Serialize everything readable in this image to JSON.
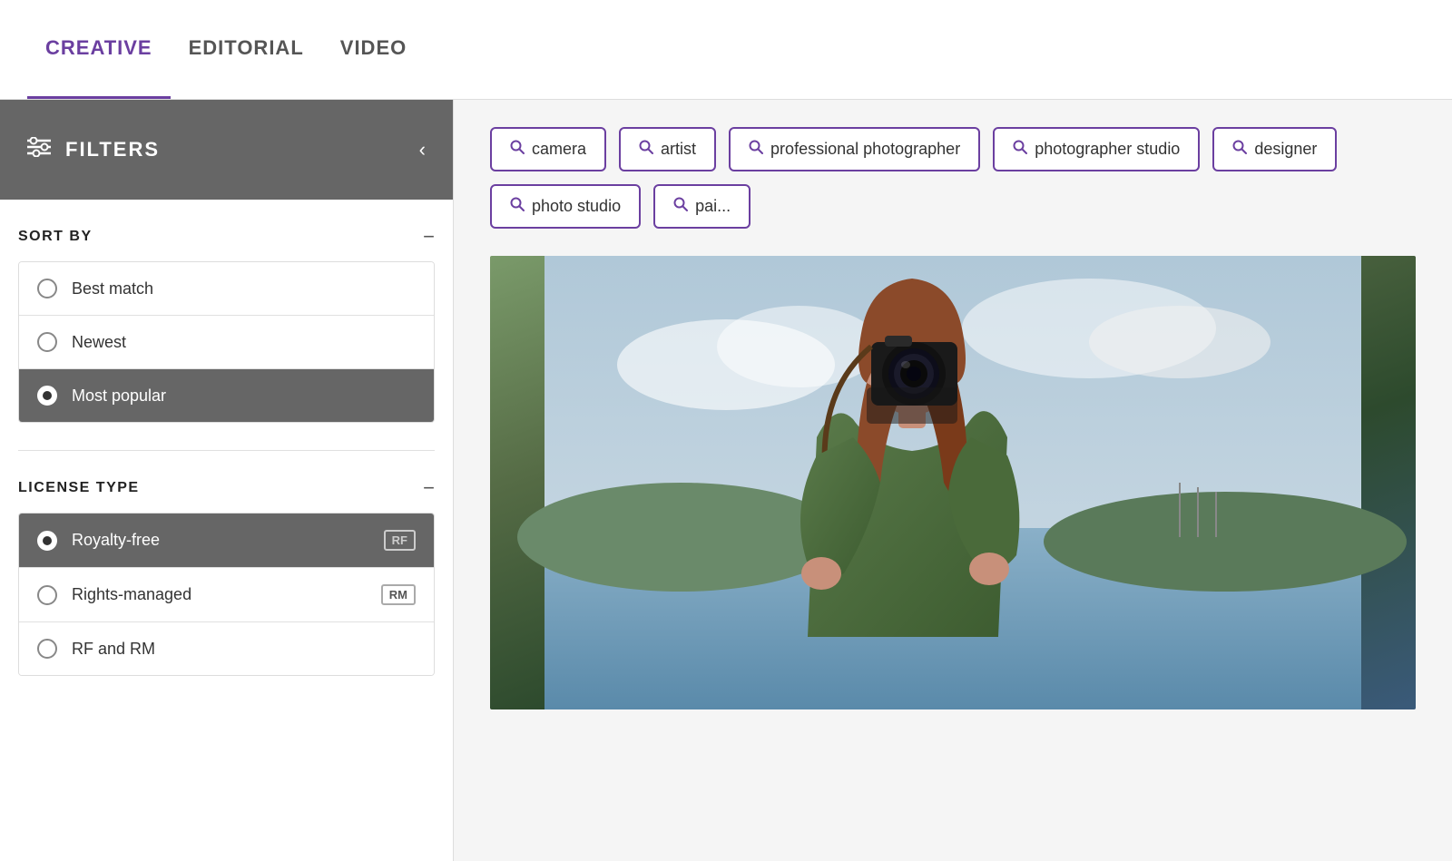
{
  "tabs": [
    {
      "id": "creative",
      "label": "CREATIVE",
      "active": true
    },
    {
      "id": "editorial",
      "label": "EDITORIAL",
      "active": false
    },
    {
      "id": "video",
      "label": "VIDEO",
      "active": false
    }
  ],
  "sidebar": {
    "header": {
      "filters_label": "FILTERS",
      "collapse_icon": "‹"
    },
    "sort_by": {
      "title": "SORT BY",
      "options": [
        {
          "id": "best-match",
          "label": "Best match",
          "selected": false
        },
        {
          "id": "newest",
          "label": "Newest",
          "selected": false
        },
        {
          "id": "most-popular",
          "label": "Most popular",
          "selected": true
        }
      ]
    },
    "license_type": {
      "title": "LICENSE TYPE",
      "options": [
        {
          "id": "royalty-free",
          "label": "Royalty-free",
          "badge": "RF",
          "selected": true
        },
        {
          "id": "rights-managed",
          "label": "Rights-managed",
          "badge": "RM",
          "selected": false
        },
        {
          "id": "rf-and-rm",
          "label": "RF and RM",
          "badge": "",
          "selected": false
        }
      ]
    }
  },
  "chips": [
    {
      "id": "camera",
      "label": "camera"
    },
    {
      "id": "artist",
      "label": "artist"
    },
    {
      "id": "professional-photographer",
      "label": "professional photographer"
    },
    {
      "id": "photographer-studio",
      "label": "photographer studio"
    },
    {
      "id": "designer",
      "label": "designer"
    },
    {
      "id": "photo-studio",
      "label": "photo studio"
    },
    {
      "id": "painter",
      "label": "pai..."
    }
  ],
  "colors": {
    "accent": "#6b3fa0",
    "sidebar_header_bg": "#666666",
    "selected_bg": "#666666",
    "tab_active": "#6b3fa0"
  }
}
